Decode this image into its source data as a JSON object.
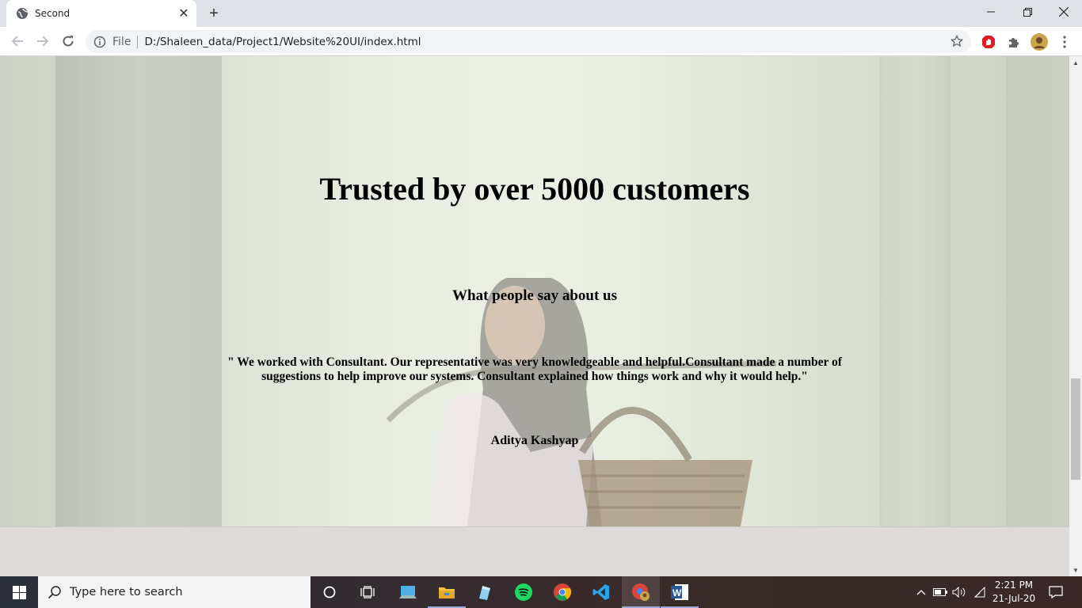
{
  "browser": {
    "tab_title": "Second",
    "address_label": "File",
    "url": "D:/Shaleen_data/Project1/Website%20UI/index.html"
  },
  "page": {
    "headline": "Trusted by over 5000 customers",
    "subheading": "What people say about us",
    "testimonial": "\" We worked with Consultant. Our representative was very knowledgeable and helpful.Consultant made a number of suggestions to help improve our systems. Consultant explained how things work and why it would help.\"",
    "author": "Aditya Kashyap"
  },
  "taskbar": {
    "search_placeholder": "Type here to search",
    "time": "2:21 PM",
    "date": "21-Jul-20"
  },
  "icons": {
    "tab_favicon": "globe-icon",
    "back": "back-arrow-icon",
    "forward": "forward-arrow-icon",
    "reload": "reload-icon",
    "site_info": "info-icon",
    "bookmark": "star-icon",
    "extension_1": "adblock-icon",
    "extensions": "puzzle-icon",
    "profile": "avatar-icon",
    "menu": "more-vert-icon"
  },
  "colors": {
    "tabbar": "#dee1e6",
    "hero_tint": "#dfe6d5",
    "page_bottom": "#dedad9",
    "taskbar": "#2a2f3a"
  }
}
